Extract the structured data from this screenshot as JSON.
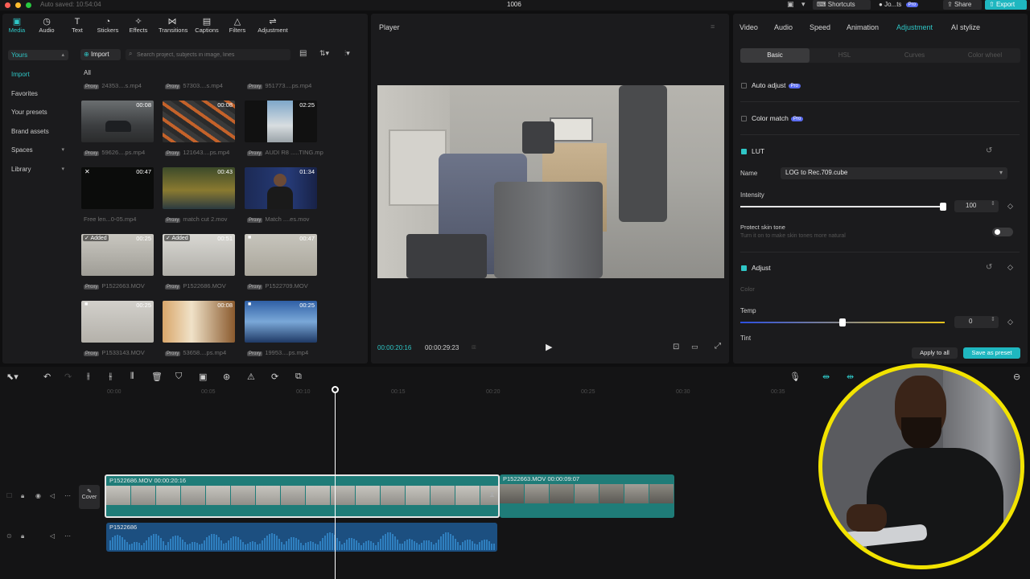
{
  "titlebar": {
    "autosave": "Auto saved: 10:54:04",
    "project_title": "1006",
    "shortcuts": "Shortcuts",
    "user": "Jo...ts",
    "user_badge": "Pro",
    "share": "Share",
    "export": "Export"
  },
  "toolbar": {
    "items": [
      {
        "label": "Media",
        "icon": "media-icon"
      },
      {
        "label": "Audio",
        "icon": "audio-icon"
      },
      {
        "label": "Text",
        "icon": "text-icon"
      },
      {
        "label": "Stickers",
        "icon": "stickers-icon"
      },
      {
        "label": "Effects",
        "icon": "effects-icon"
      },
      {
        "label": "Transitions",
        "icon": "transitions-icon"
      },
      {
        "label": "Captions",
        "icon": "captions-icon"
      },
      {
        "label": "Filters",
        "icon": "filters-icon"
      },
      {
        "label": "Adjustment",
        "icon": "adjustment-icon"
      }
    ],
    "active": "Media"
  },
  "sidebar": {
    "items": [
      {
        "label": "Yours",
        "selected": true
      },
      {
        "label": "Import"
      },
      {
        "label": "Favorites"
      },
      {
        "label": "Your presets"
      },
      {
        "label": "Brand assets"
      },
      {
        "label": "Spaces"
      },
      {
        "label": "Library"
      }
    ]
  },
  "media": {
    "import_label": "Import",
    "search_placeholder": "Search project, subjects in image, lines",
    "filter_all": "All",
    "badge": "Proxy",
    "top_names": [
      "24353....s.mp4",
      "57303....s.mp4",
      "951773....ps.mp4"
    ],
    "rows": [
      [
        {
          "duration": "00:08",
          "name": "59626....ps.mp4"
        },
        {
          "duration": "00:08",
          "name": "121643....ps.mp4"
        },
        {
          "duration": "02:25",
          "name": "AUDI R8 .....TING.mp4"
        }
      ],
      [
        {
          "duration": "00:47",
          "name": "Free len...0-05.mp4"
        },
        {
          "duration": "00:43",
          "name": "match cut 2.mov"
        },
        {
          "duration": "01:34",
          "name": "Match ....es.mov"
        }
      ],
      [
        {
          "duration": "00:25",
          "name": "P1522663.MOV",
          "tag": "Added"
        },
        {
          "duration": "00:51",
          "name": "P1522686.MOV",
          "tag": "Added"
        },
        {
          "duration": "00:47",
          "name": "P1522709.MOV"
        }
      ],
      [
        {
          "duration": "00:25",
          "name": "P1533143.MOV"
        },
        {
          "duration": "00:08",
          "name": "53658....ps.mp4"
        },
        {
          "duration": "00:25",
          "name": "19953....ps.mp4"
        }
      ]
    ]
  },
  "player": {
    "title": "Player",
    "current_time": "00:00:20:16",
    "total_time": "00:00:29:23"
  },
  "props": {
    "tabs": [
      "Video",
      "Audio",
      "Speed",
      "Animation",
      "Adjustment",
      "AI stylize"
    ],
    "active_tab": "Adjustment",
    "subtabs": [
      "Basic",
      "HSL",
      "Curves",
      "Color wheel"
    ],
    "active_subtab": "Basic",
    "auto_adjust": "Auto adjust",
    "color_match": "Color match",
    "pro": "Pro",
    "lut_label": "LUT",
    "name_label": "Name",
    "lut_name": "LOG to Rec.709.cube",
    "intensity_label": "Intensity",
    "intensity_value": "100",
    "intensity_fraction": 1.0,
    "protect_skin": "Protect skin tone",
    "protect_skin_desc": "Turn it on to make skin tones more natural",
    "adjust_label": "Adjust",
    "color_label": "Color",
    "temp_label": "Temp",
    "temp_value": "0",
    "tint_label": "Tint",
    "apply_all": "Apply to all",
    "save_preset": "Save as preset"
  },
  "timeline": {
    "ruler": [
      "00:00",
      "00:05",
      "00:10",
      "00:15",
      "00:20",
      "00:25",
      "00:30",
      "00:35"
    ],
    "cover_label": "Cover",
    "clip1": "P1522686.MOV  00:00:20:16",
    "clip2": "P1522663.MOV  00:00:09:07",
    "audio_clip": "P1522686"
  },
  "colors": {
    "accent": "#2fc6c6",
    "export": "#1fb7c0",
    "webcam_ring": "#f2e300",
    "clip": "#1f7c78",
    "audio": "#1c4f80"
  }
}
